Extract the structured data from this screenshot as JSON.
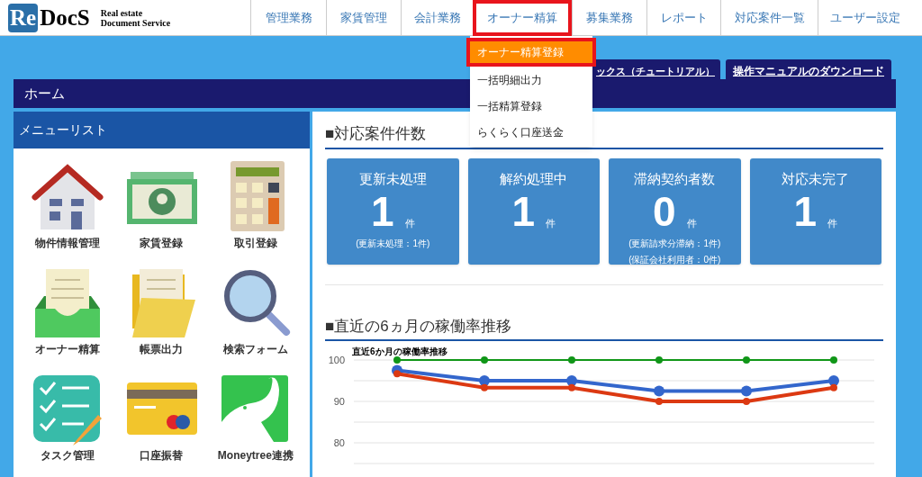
{
  "logo": {
    "mark": "Re",
    "name": "DocS",
    "tagline_1": "Real estate",
    "tagline_2": "Document Service"
  },
  "nav": [
    {
      "label": "管理業務",
      "selected": false
    },
    {
      "label": "家賃管理",
      "selected": false
    },
    {
      "label": "会計業務",
      "selected": false
    },
    {
      "label": "オーナー精算",
      "selected": true
    },
    {
      "label": "募集業務",
      "selected": false
    },
    {
      "label": "レポート",
      "selected": false
    },
    {
      "label": "対応案件一覧",
      "selected": false
    },
    {
      "label": "ユーザー設定",
      "selected": false
    }
  ],
  "dropdown": [
    {
      "label": "オーナー精算登録",
      "selected": true
    },
    {
      "label": "一括明細出力",
      "selected": false
    },
    {
      "label": "一括精算登録",
      "selected": false
    },
    {
      "label": "らくらく口座送金",
      "selected": false
    }
  ],
  "tabs": [
    "ックス（チュートリアル）",
    "操作マニュアルのダウンロード"
  ],
  "page_title": "ホーム",
  "menu": {
    "title": "メニューリスト",
    "items": [
      "物件情報管理",
      "家賃登録",
      "取引登録",
      "オーナー精算",
      "帳票出力",
      "検索フォーム",
      "タスク管理",
      "口座振替",
      "Moneytree連携"
    ]
  },
  "cases": {
    "title": "■対応案件件数",
    "cards": [
      {
        "label": "更新未処理",
        "count": "1",
        "unit": "件",
        "notes": [
          "(更新未処理：1件)"
        ]
      },
      {
        "label": "解約処理中",
        "count": "1",
        "unit": "件"
      },
      {
        "label": "滞納契約者数",
        "count": "0",
        "unit": "件",
        "notes": [
          "(更新請求分滞納：1件)",
          "(保証会社利用者：0件)"
        ]
      },
      {
        "label": "対応未完了",
        "count": "1",
        "unit": "件"
      }
    ]
  },
  "occupancy": {
    "title": "■直近の6ヵ月の稼働率推移",
    "chart_data": {
      "type": "line",
      "title": "直近6か月の稼働率推移",
      "ylim": [
        75,
        100
      ],
      "yticks": [
        80,
        90,
        100
      ],
      "grid": true,
      "series": [
        {
          "color": "#109618",
          "marker": true,
          "values": [
            100,
            100,
            100,
            100,
            100,
            100
          ]
        },
        {
          "color": "#3366cc",
          "marker": true,
          "values": [
            97.5,
            95,
            95,
            92.5,
            92.5,
            95
          ]
        },
        {
          "color": "#dc3912",
          "marker": true,
          "values": [
            96.7,
            93.3,
            93.3,
            90,
            90,
            93.3
          ]
        }
      ]
    }
  }
}
